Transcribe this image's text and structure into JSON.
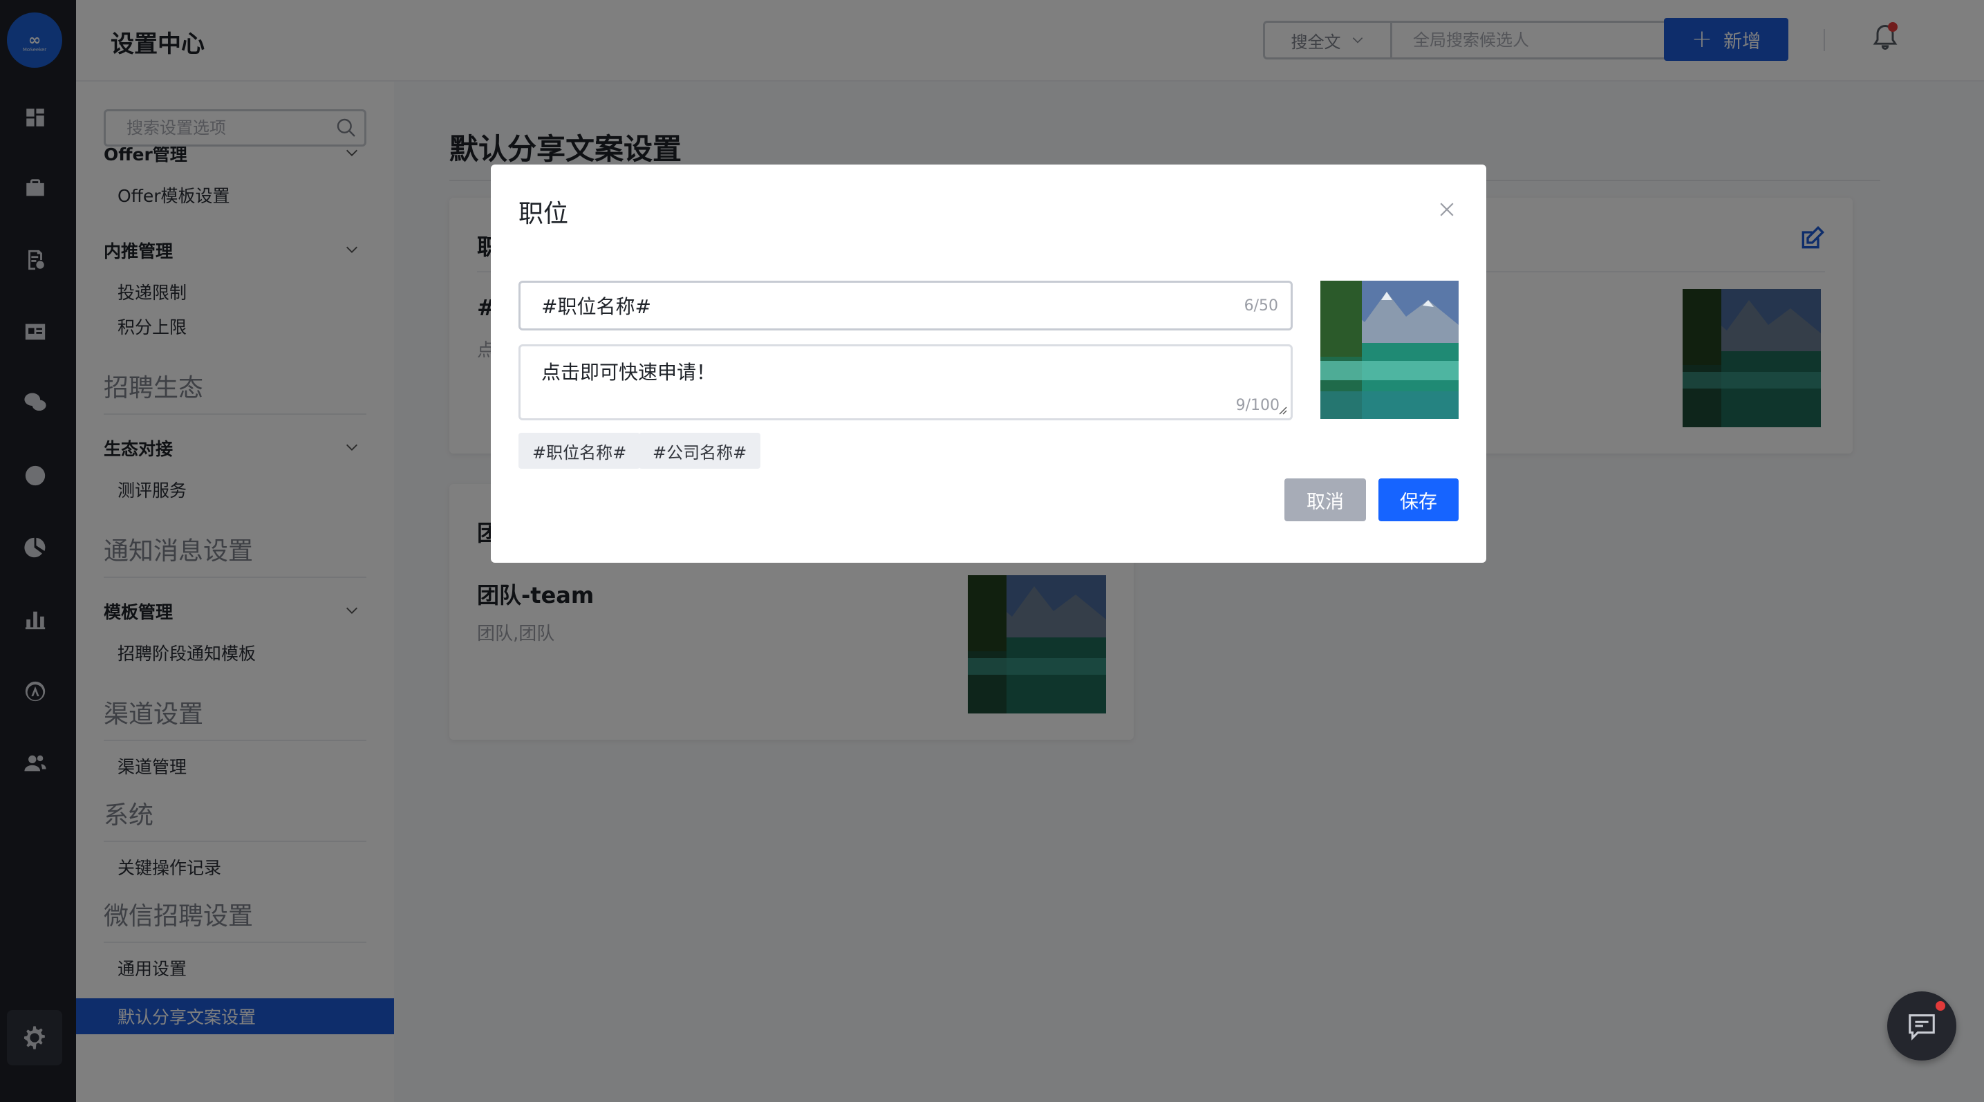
{
  "header": {
    "title": "设置中心",
    "search_scope": "搜全文",
    "search_placeholder": "全局搜索候选人",
    "add_label": "新增"
  },
  "rail": {
    "logo_text": "∞",
    "logo_sub": "MoSeeker"
  },
  "sidebar": {
    "search_placeholder": "搜索设置选项",
    "groups": [
      {
        "label": "Offer管理",
        "items": [
          "Offer模板设置"
        ]
      },
      {
        "label": "内推管理",
        "items": [
          "投递限制",
          "积分上限"
        ]
      }
    ],
    "sections": [
      {
        "label": "招聘生态"
      },
      {
        "label": "通知消息设置"
      },
      {
        "label": "渠道设置"
      },
      {
        "label": "系统"
      },
      {
        "label": "微信招聘设置"
      }
    ],
    "eco_group": {
      "label": "生态对接",
      "items": [
        "测评服务"
      ]
    },
    "notify_group": {
      "label": "模板管理",
      "items": [
        "招聘阶段通知模板"
      ]
    },
    "channel_items": [
      "渠道管理"
    ],
    "system_items": [
      "关键操作记录"
    ],
    "wechat_items": [
      "通用设置"
    ],
    "active_item": "默认分享文案设置"
  },
  "main": {
    "page_title": "默认分享文案设置",
    "card1": {
      "head": "职",
      "title": "#",
      "desc": "点"
    },
    "card2": {
      "head": "团",
      "title": "团队-team",
      "desc": "团队,团队"
    }
  },
  "modal": {
    "title": "职位",
    "title_input_value": "#职位名称#",
    "title_count": "6/50",
    "desc_value": "点击即可快速申请！",
    "desc_count": "9/100",
    "tags": [
      "#职位名称#",
      "#公司名称#"
    ],
    "cancel_label": "取消",
    "save_label": "保存"
  },
  "colors": {
    "primary": "#1c5ad6",
    "save": "#1664ff",
    "rail_bg": "#1f2129"
  }
}
